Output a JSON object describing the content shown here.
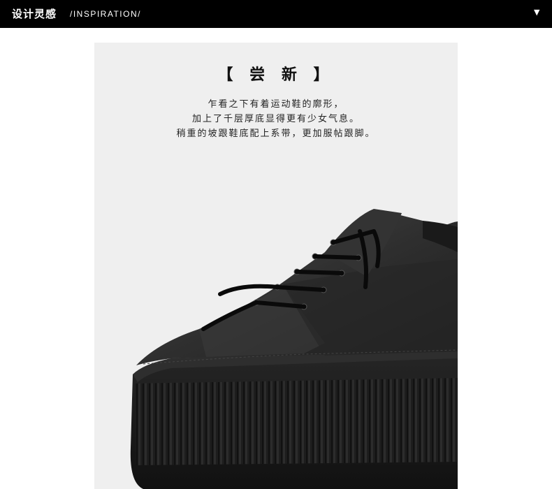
{
  "header": {
    "title_zh": "设计灵感",
    "title_en": "/INSPIRATION/",
    "toggle_icon": "caret-down-icon"
  },
  "colors": {
    "header_bg": "#000000",
    "panel_bg": "#efefef",
    "text": "#222222"
  },
  "section": {
    "heading": "【 尝 新 】",
    "lines": [
      "乍看之下有着运动鞋的廓形，",
      "加上了千层厚底显得更有少女气息。",
      "稍重的坡跟鞋底配上系带，更加服帖跟脚。"
    ],
    "image": "black-platform-sneaker"
  }
}
